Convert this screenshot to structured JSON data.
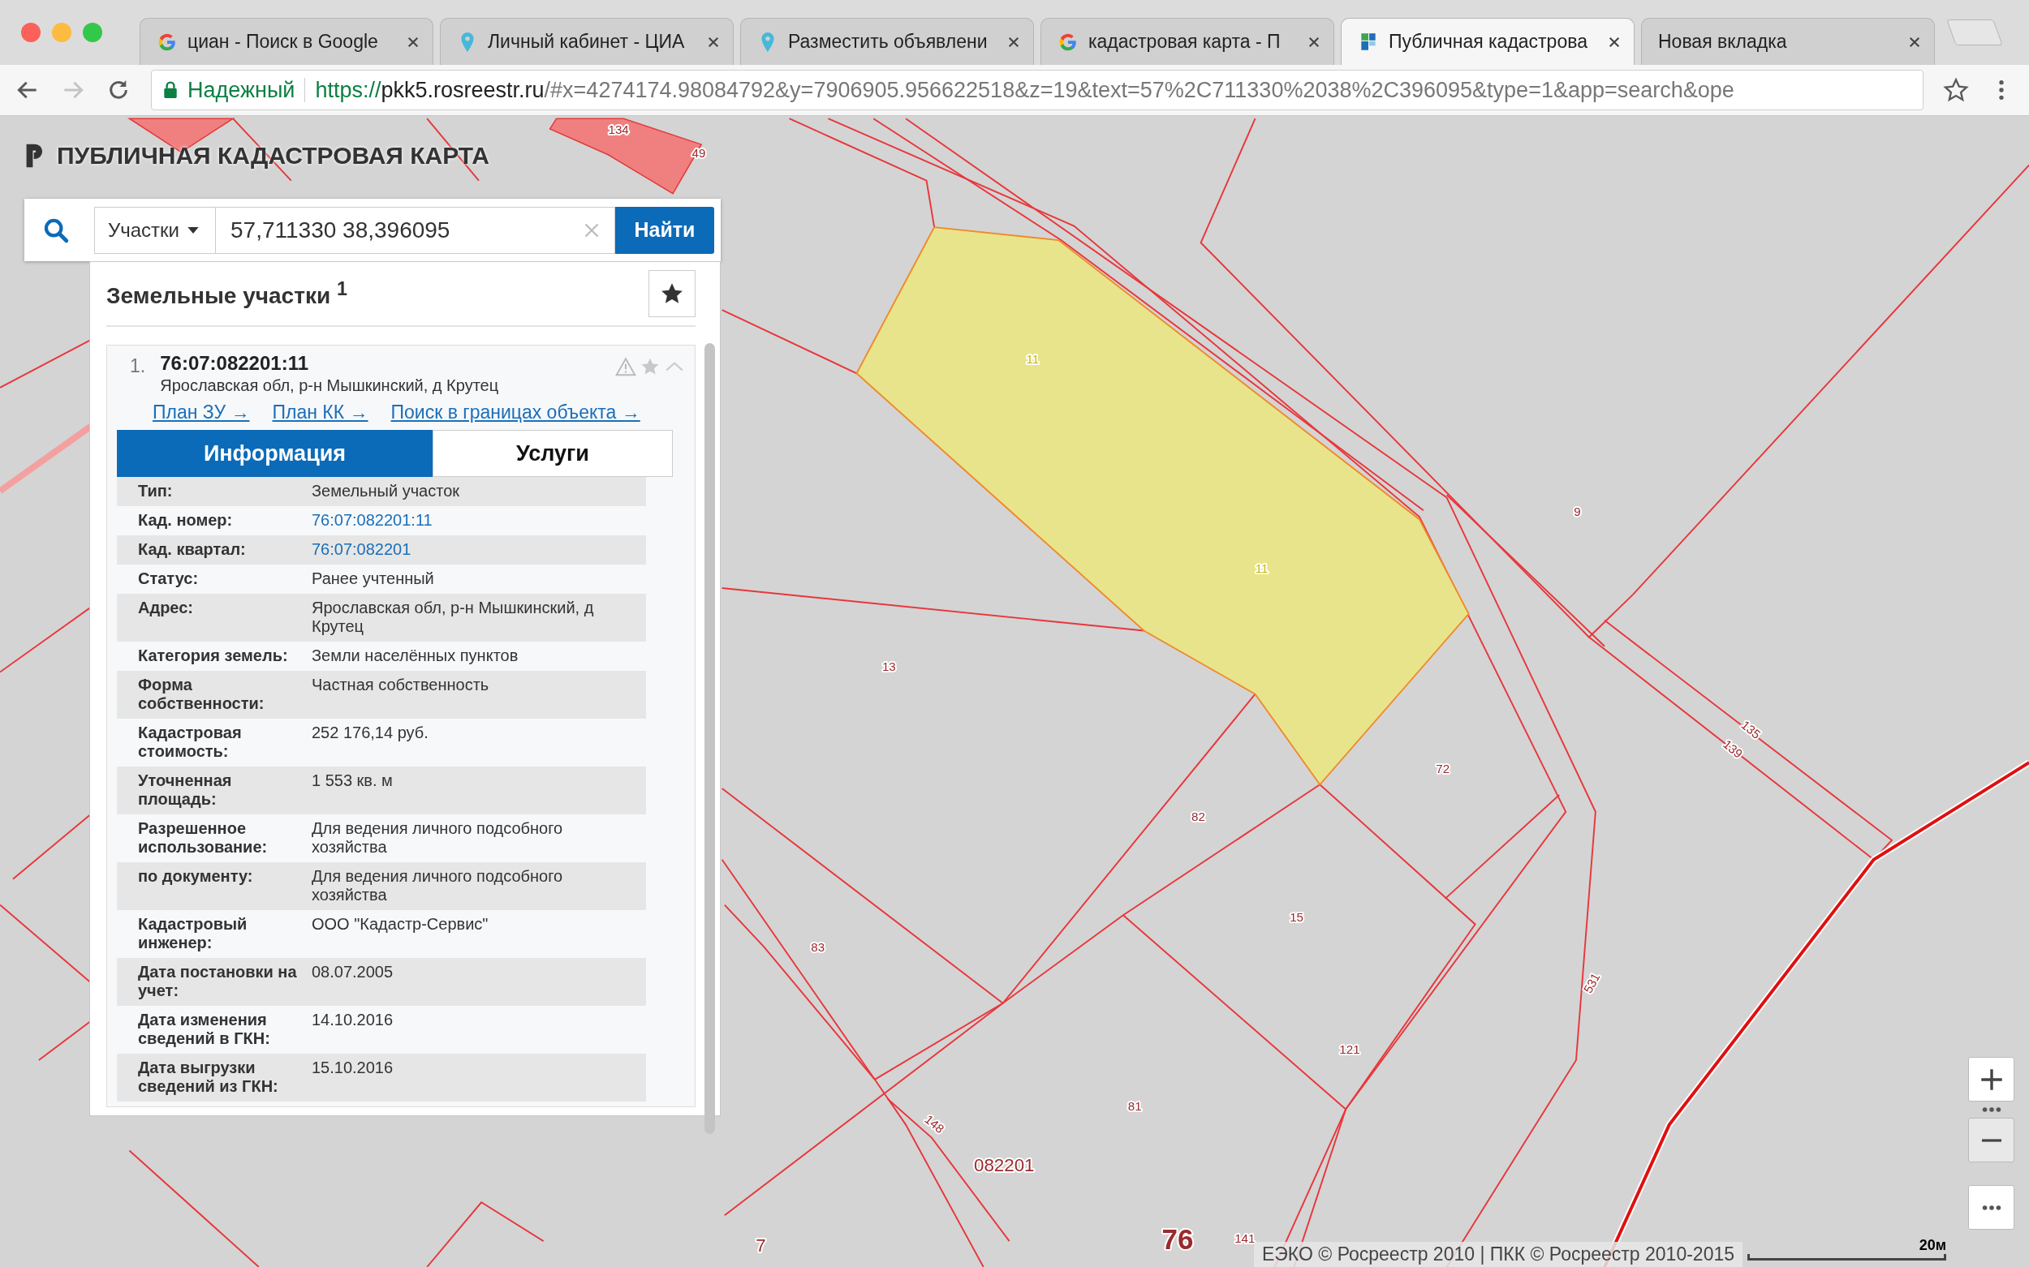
{
  "browser": {
    "tabs": [
      {
        "title": "циан - Поиск в Google",
        "selected": false
      },
      {
        "title": "Личный кабинет - ЦИА",
        "selected": false
      },
      {
        "title": "Разместить объявлени",
        "selected": false
      },
      {
        "title": "кадастровая карта - П",
        "selected": false
      },
      {
        "title": "Публичная кадастрова",
        "selected": true
      },
      {
        "title": "Новая вкладка",
        "selected": false
      }
    ],
    "nav": {
      "back_disabled": false,
      "forward_disabled": true
    },
    "address": {
      "security": "Надежный",
      "scheme": "https://",
      "host": "pkk5.rosreestr.ru",
      "path": "/#x=4274174.98084792&y=7906905.956622518&z=19&text=57%2C711330%2038%2C396095&type=1&app=search&ope"
    }
  },
  "app": {
    "title": "ПУБЛИЧНАЯ КАДАСТРОВАЯ КАРТА",
    "search": {
      "category": "Участки",
      "value": "57,711330 38,396095",
      "button": "Найти"
    },
    "results": {
      "heading": "Земельные участки $^{1}$",
      "items": [
        {
          "index": "1.",
          "number": "76:07:082201:11",
          "address": "Ярославская обл, р-н Мышкинский, д Крутец",
          "links": [
            "План ЗУ →",
            "План КК →",
            "Поиск в границах объекта →"
          ],
          "tabs": [
            {
              "label": "Информация",
              "selected": true
            },
            {
              "label": "Услуги",
              "selected": false
            }
          ],
          "rows": [
            {
              "label": "Тип:",
              "value": "Земельный участок",
              "kind": "text"
            },
            {
              "label": "Кад. номер:",
              "value": "76:07:082201:11",
              "kind": "link"
            },
            {
              "label": "Кад. квартал:",
              "value": "76:07:082201",
              "kind": "link"
            },
            {
              "label": "Статус:",
              "value": "Ранее учтенный",
              "kind": "text"
            },
            {
              "label": "Адрес:",
              "value": "Ярославская обл, р-н Мышкинский, д Крутец",
              "kind": "text"
            },
            {
              "label": "Категория земель:",
              "value": "Земли населённых пунктов",
              "kind": "text"
            },
            {
              "label": "Форма собственности:",
              "value": "Частная собственность",
              "kind": "text"
            },
            {
              "label": "Кадастровая стоимость:",
              "value": "252 176,14 руб.",
              "kind": "text"
            },
            {
              "label": "Уточненная площадь:",
              "value": "1 553 кв. м",
              "kind": "text"
            },
            {
              "label": "Разрешенное использование:",
              "value": "Для ведения личного подсобного хозяйства",
              "kind": "text"
            },
            {
              "label": "по документу:",
              "value": "Для ведения личного подсобного хозяйства",
              "kind": "text"
            },
            {
              "label": "Кадастровый инженер:",
              "value": "ООО \"Кадастр-Сервис\"",
              "kind": "text"
            },
            {
              "label": "Дата постановки на учет:",
              "value": "08.07.2005",
              "kind": "text"
            },
            {
              "label": "Дата изменения сведений в ГКН:",
              "value": "14.10.2016",
              "kind": "text"
            },
            {
              "label": "Дата выгрузки сведений из ГКН:",
              "value": "15.10.2016",
              "kind": "text"
            }
          ]
        }
      ]
    }
  },
  "map": {
    "labels": [
      {
        "text": "134",
        "kind": "parcel"
      },
      {
        "text": "49",
        "kind": "parcel"
      },
      {
        "text": "11",
        "kind": "selected"
      },
      {
        "text": "11",
        "kind": "selected"
      },
      {
        "text": "13",
        "kind": "parcel"
      },
      {
        "text": "9",
        "kind": "parcel"
      },
      {
        "text": "72",
        "kind": "parcel"
      },
      {
        "text": "82",
        "kind": "parcel"
      },
      {
        "text": "15",
        "kind": "parcel"
      },
      {
        "text": "83",
        "kind": "parcel"
      },
      {
        "text": "121",
        "kind": "parcel"
      },
      {
        "text": "81",
        "kind": "parcel"
      },
      {
        "text": "148",
        "kind": "parcel"
      },
      {
        "text": "135",
        "kind": "parcel"
      },
      {
        "text": "139",
        "kind": "parcel"
      },
      {
        "text": "531",
        "kind": "parcel"
      },
      {
        "text": "082201",
        "kind": "quarter"
      },
      {
        "text": "7",
        "kind": "quarter"
      },
      {
        "text": "76",
        "kind": "district"
      },
      {
        "text": "141",
        "kind": "parcel"
      }
    ],
    "attribution": "ЕЭКО © Росреестр 2010 | ПКК © Росреестр 2010-2015",
    "scale": "20м"
  }
}
